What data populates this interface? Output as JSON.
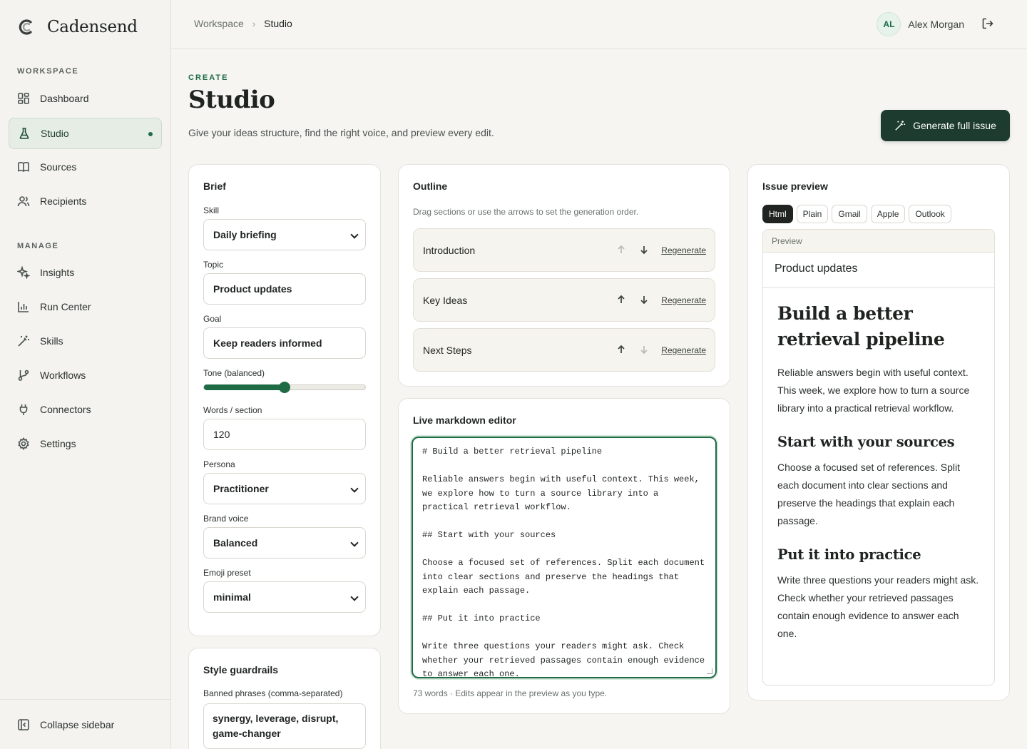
{
  "brand": {
    "name": "Cadensend"
  },
  "sidebar": {
    "workspace_heading": "WORKSPACE",
    "manage_heading": "MANAGE",
    "workspace_items": [
      {
        "label": "Dashboard",
        "icon": "dashboard-icon"
      },
      {
        "label": "Studio",
        "icon": "flask-icon",
        "active": true
      },
      {
        "label": "Sources",
        "icon": "book-icon"
      },
      {
        "label": "Recipients",
        "icon": "users-icon"
      }
    ],
    "manage_items": [
      {
        "label": "Insights",
        "icon": "sparkles-icon"
      },
      {
        "label": "Run Center",
        "icon": "bar-chart-icon"
      },
      {
        "label": "Skills",
        "icon": "wand-icon"
      },
      {
        "label": "Workflows",
        "icon": "git-branch-icon"
      },
      {
        "label": "Connectors",
        "icon": "plug-icon"
      },
      {
        "label": "Settings",
        "icon": "gear-icon"
      }
    ],
    "collapse_label": "Collapse sidebar"
  },
  "topbar": {
    "breadcrumb": [
      "Workspace",
      "Studio"
    ],
    "user": {
      "initials": "AL",
      "name": "Alex Morgan"
    }
  },
  "page": {
    "eyebrow": "CREATE",
    "title": "Studio",
    "subtitle": "Give your ideas structure, find the right voice, and preview every edit.",
    "generate_label": "Generate full issue"
  },
  "brief": {
    "title": "Brief",
    "skill": {
      "label": "Skill",
      "value": "Daily briefing"
    },
    "topic": {
      "label": "Topic",
      "value": "Product updates"
    },
    "goal": {
      "label": "Goal",
      "value": "Keep readers informed"
    },
    "tone": {
      "label": "Tone (balanced)",
      "level": 0.5
    },
    "words": {
      "label": "Words / section",
      "value": "120"
    },
    "persona": {
      "label": "Persona",
      "value": "Practitioner"
    },
    "brand_voice": {
      "label": "Brand voice",
      "value": "Balanced"
    },
    "emoji": {
      "label": "Emoji preset",
      "value": "minimal"
    }
  },
  "guardrails": {
    "title": "Style guardrails",
    "banned_label": "Banned phrases (comma-separated)",
    "banned_value": "synergy, leverage, disrupt, game-changer"
  },
  "outline": {
    "title": "Outline",
    "hint": "Drag sections or use the arrows to set the generation order.",
    "regenerate_label": "Regenerate",
    "sections": [
      {
        "name": "Introduction",
        "up_disabled": true,
        "down_disabled": false
      },
      {
        "name": "Key Ideas",
        "up_disabled": false,
        "down_disabled": false
      },
      {
        "name": "Next Steps",
        "up_disabled": false,
        "down_disabled": true
      }
    ]
  },
  "editor": {
    "title": "Live markdown editor",
    "lines": [
      "# Build a better retrieval pipeline",
      "",
      "Reliable answers begin with useful context. This week,",
      "we explore how to turn a source library into a",
      "practical retrieval workflow.",
      "",
      "## Start with your sources",
      "",
      "Choose a focused set of references. Split each document",
      "into clear sections and preserve the headings that",
      "explain each passage.",
      "",
      "## Put it into practice",
      "",
      "Write three questions your readers might ask. Check",
      "whether your retrieved passages contain enough evidence",
      "to answer each one."
    ],
    "footer": "73 words · Edits appear in the preview as you type."
  },
  "preview": {
    "title": "Issue preview",
    "tabs": [
      "Html",
      "Plain",
      "Gmail",
      "Apple",
      "Outlook"
    ],
    "active_tab": "Html",
    "frame_label": "Preview",
    "subject": "Product updates",
    "h1": "Build a better retrieval pipeline",
    "p1": "Reliable answers begin with useful context. This week, we explore how to turn a source library into a practical retrieval workflow.",
    "h2a": "Start with your sources",
    "p2": "Choose a focused set of references. Split each document into clear sections and preserve the headings that explain each passage.",
    "h2b": "Put it into practice",
    "p3": "Write three questions your readers might ask. Check whether your retrieved passages contain enough evidence to answer each one."
  },
  "colors": {
    "accent": "#1e6b45",
    "primary_button": "#1d3b2e",
    "active_nav_bg": "#e6ede5"
  }
}
